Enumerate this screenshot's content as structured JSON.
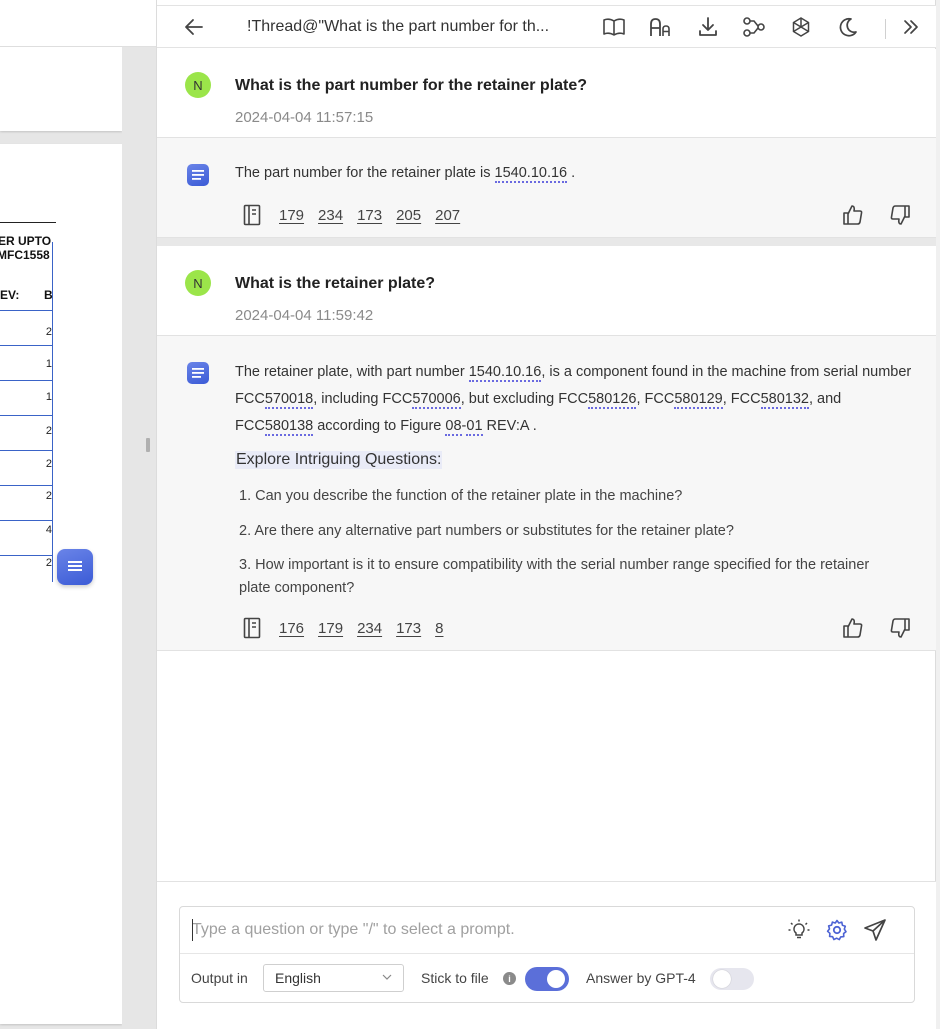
{
  "header": {
    "title": "!Thread@\"What is the part number for th...",
    "icons": [
      "back-arrow-icon",
      "book-icon",
      "font-size-icon",
      "download-icon",
      "share-icon",
      "openai-icon",
      "moon-icon",
      "double-chevron-right-icon"
    ]
  },
  "document": {
    "header_line1": "ER UPTO",
    "header_line2": "MFC1558",
    "rev_label": "EV:",
    "rev_col": "B",
    "row_values": [
      "2",
      "1",
      "1",
      "2",
      "2",
      "2",
      "4",
      "2"
    ]
  },
  "messages": [
    {
      "role": "user",
      "avatar": "N",
      "text": "What is the part number for the retainer plate?",
      "timestamp": "2024-04-04 11:57:15"
    },
    {
      "role": "assistant",
      "text_before": "The part number for the retainer plate is ",
      "part": "1540.10.16",
      "text_after": " .",
      "refs": [
        "179",
        "234",
        "173",
        "205",
        "207"
      ]
    },
    {
      "role": "user",
      "avatar": "N",
      "text": "What is the retainer plate?",
      "timestamp": "2024-04-04 11:59:42"
    },
    {
      "role": "assistant",
      "seg1": "The retainer plate, with part number ",
      "part": "1540.10.16",
      "seg2": ", is a component found in the machine from serial number FCC",
      "serial1": "570018",
      "seg3": ", including FCC",
      "serial2": "570006",
      "seg4": ", but excluding FCC",
      "serial3": "580126",
      "seg5": ", FCC",
      "serial4": "580129",
      "seg6": ", FCC",
      "serial5": "580132",
      "seg7": ", and FCC",
      "serial6": "580138",
      "seg8": " according to Figure ",
      "fig1": "08",
      "fig_dash": "-",
      "fig2": "01",
      "seg9": " REV:A .",
      "explore_title": "Explore Intriguing Questions:",
      "questions": [
        "1. Can you describe the function of the retainer plate in the machine?",
        "2. Are there any alternative part numbers or substitutes for the retainer plate?",
        "3. How important is it to ensure compatibility with the serial number range specified for the retainer plate component?"
      ],
      "refs": [
        "176",
        "179",
        "234",
        "173",
        "8"
      ]
    }
  ],
  "composer": {
    "placeholder": "Type a question or type \"/\" to select a prompt.",
    "output_label": "Output in",
    "language": "English",
    "stick_label": "Stick to file",
    "stick_enabled": true,
    "gpt4_label": "Answer by GPT-4",
    "gpt4_enabled": false
  },
  "colors": {
    "accent": "#5b6fd9",
    "avatar_bg": "#9be54a",
    "explore_bg": "#e9ebf7",
    "doc_table_line": "#3a63c7"
  }
}
